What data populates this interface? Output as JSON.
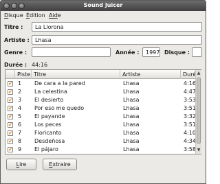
{
  "window": {
    "title": "Sound Juicer"
  },
  "menu": [
    {
      "mnemonic": "D",
      "rest": "isque"
    },
    {
      "mnemonic": "É",
      "rest": "dition"
    },
    {
      "mnemonic": "Aid",
      "rest": "e"
    }
  ],
  "album": {
    "title_label": "Titre :",
    "title_value": "La Llorona",
    "artist_label": "Artiste :",
    "artist_value": "Lhasa",
    "genre_label": "Genre :",
    "genre_value": "",
    "year_label": "Année :",
    "year_value": "1997",
    "disc_label": "Disque :",
    "disc_value": "",
    "duration_label": "Durée :",
    "duration_value": "44:16"
  },
  "tracklist": {
    "columns": {
      "track": "Piste",
      "title": "Titre",
      "artist": "Artiste",
      "duration": "Durée"
    },
    "rows": [
      {
        "checked": true,
        "track": "1",
        "title": "De cara a la pared",
        "artist": "Lhasa",
        "duration": "4:16"
      },
      {
        "checked": true,
        "track": "2",
        "title": "La celestina",
        "artist": "Lhasa",
        "duration": "4:47"
      },
      {
        "checked": true,
        "track": "3",
        "title": "El desierto",
        "artist": "Lhasa",
        "duration": "3:53"
      },
      {
        "checked": true,
        "track": "4",
        "title": "Por eso me quedo",
        "artist": "Lhasa",
        "duration": "3:51"
      },
      {
        "checked": true,
        "track": "5",
        "title": "El payande",
        "artist": "Lhasa",
        "duration": "3:32"
      },
      {
        "checked": true,
        "track": "6",
        "title": "Los peces",
        "artist": "Lhasa",
        "duration": "3:51"
      },
      {
        "checked": true,
        "track": "7",
        "title": "Floricanto",
        "artist": "Lhasa",
        "duration": "4:10"
      },
      {
        "checked": true,
        "track": "8",
        "title": "Desdeñosa",
        "artist": "Lhasa",
        "duration": "4:34"
      },
      {
        "checked": true,
        "track": "9",
        "title": "El pájaro",
        "artist": "Lhasa",
        "duration": "3:58"
      }
    ]
  },
  "buttons": {
    "read": {
      "mnemonic": "L",
      "rest": "ire"
    },
    "extract": {
      "mnemonic": "E",
      "rest": "xtraire"
    }
  },
  "colors": {
    "titlebar": "#4f4f4f",
    "checkmark": "#d47a00",
    "window_bg": "#eceae6"
  },
  "icons": [
    "window-close-icon",
    "window-minimize-icon",
    "window-maximize-icon",
    "checkbox-checked-icon",
    "scroll-up-icon",
    "scroll-down-icon"
  ]
}
